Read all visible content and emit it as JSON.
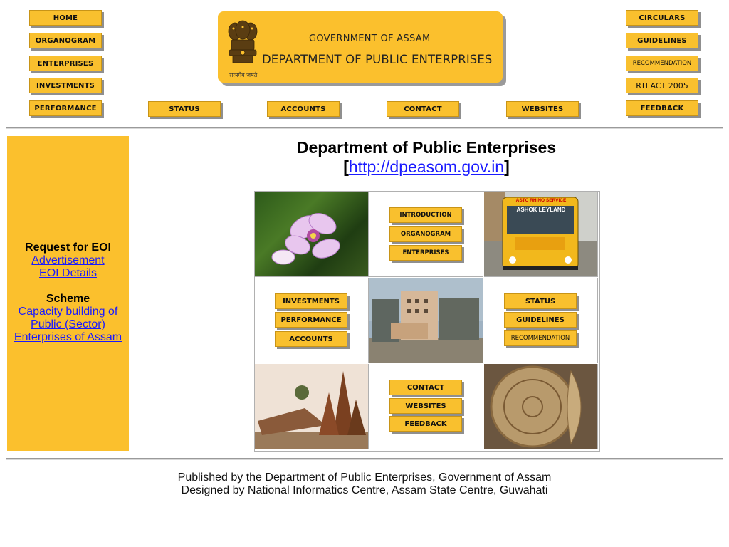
{
  "banner": {
    "line1": "GOVERNMENT OF ASSAM",
    "line2": "DEPARTMENT OF PUBLIC ENTERPRISES",
    "motto": "सत्यमेव जयते"
  },
  "nav_left": [
    "HOME",
    "ORGANOGRAM",
    "ENTERPRISES",
    "INVESTMENTS",
    "PERFORMANCE"
  ],
  "nav_right": [
    "CIRCULARS",
    "GUIDELINES",
    "RECOMMENDATION",
    "RTI ACT 2005",
    "FEEDBACK"
  ],
  "nav_bottom": [
    "STATUS",
    "ACCOUNTS",
    "CONTACT",
    "WEBSITES"
  ],
  "main": {
    "title": "Department of Public Enterprises",
    "url_open": "[",
    "url": "http://dpeasom.gov.in",
    "url_close": "]"
  },
  "side": {
    "eoi_heading": "Request for EOI",
    "eoi_links": [
      "Advertisement",
      "EOI Details"
    ],
    "scheme_heading": "Scheme",
    "scheme_link": "Capacity building of Public (Sector) Enterprises of Assam"
  },
  "grid": {
    "cell_top_middle": [
      "INTRODUCTION",
      "ORGANOGRAM",
      "ENTERPRISES"
    ],
    "cell_mid_left": [
      "INVESTMENTS",
      "PERFORMANCE",
      "ACCOUNTS"
    ],
    "cell_mid_right": [
      "STATUS",
      "GUIDELINES",
      "RECOMMENDATION"
    ],
    "cell_bottom_middle": [
      "CONTACT",
      "WEBSITES",
      "FEEDBACK"
    ],
    "bus_text": [
      "ASTC RHINO SERVICE",
      "ASHOK LEYLAND"
    ]
  },
  "footer": {
    "line1": "Published by the Department of Public Enterprises, Government of Assam",
    "line2": "Designed by National Informatics Centre, Assam State Centre, Guwahati"
  },
  "colors": {
    "accent": "#fbc02d",
    "link": "#1a1aff"
  }
}
